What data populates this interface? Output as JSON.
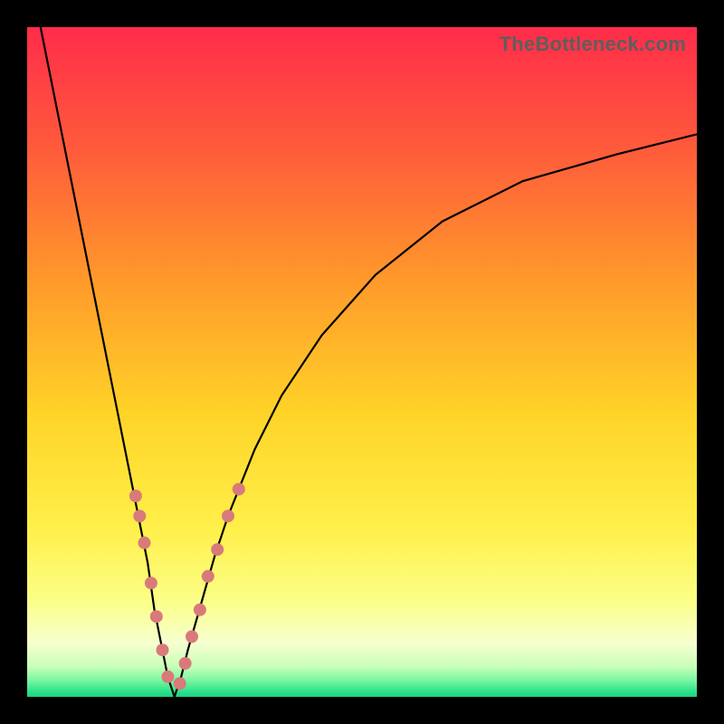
{
  "watermark": "TheBottleneck.com",
  "colors": {
    "frame_bg": "#000000",
    "curve": "#000000",
    "marker": "#d97a7a"
  },
  "gradient_stops": [
    {
      "offset": 0.0,
      "color": "#ff2c4a"
    },
    {
      "offset": 0.18,
      "color": "#ff5a3b"
    },
    {
      "offset": 0.38,
      "color": "#ff9a2a"
    },
    {
      "offset": 0.58,
      "color": "#ffd428"
    },
    {
      "offset": 0.75,
      "color": "#fff04a"
    },
    {
      "offset": 0.86,
      "color": "#fbff8a"
    },
    {
      "offset": 0.92,
      "color": "#f6ffd0"
    },
    {
      "offset": 0.955,
      "color": "#c8ffb8"
    },
    {
      "offset": 0.975,
      "color": "#7bf7a2"
    },
    {
      "offset": 0.99,
      "color": "#34e58e"
    },
    {
      "offset": 1.0,
      "color": "#18d47e"
    }
  ],
  "chart_data": {
    "type": "line",
    "title": "",
    "xlabel": "",
    "ylabel": "",
    "xlim": [
      0,
      100
    ],
    "ylim": [
      0,
      100
    ],
    "x_trough": 22,
    "series": [
      {
        "name": "left-branch",
        "x": [
          2,
          4,
          6,
          8,
          10,
          12,
          14,
          16,
          18,
          19,
          20,
          21,
          22
        ],
        "y": [
          100,
          90,
          80,
          70,
          60,
          50,
          40,
          30,
          20,
          13,
          8,
          3,
          0
        ]
      },
      {
        "name": "right-branch",
        "x": [
          22,
          23,
          24,
          26,
          28,
          30,
          34,
          38,
          44,
          52,
          62,
          74,
          88,
          100
        ],
        "y": [
          0,
          3,
          7,
          14,
          21,
          27,
          37,
          45,
          54,
          63,
          71,
          77,
          81,
          84
        ]
      }
    ],
    "markers": [
      {
        "branch": "left-branch",
        "x": 16.2,
        "y": 30
      },
      {
        "branch": "left-branch",
        "x": 16.8,
        "y": 27
      },
      {
        "branch": "left-branch",
        "x": 17.5,
        "y": 23
      },
      {
        "branch": "left-branch",
        "x": 18.5,
        "y": 17
      },
      {
        "branch": "left-branch",
        "x": 19.3,
        "y": 12
      },
      {
        "branch": "left-branch",
        "x": 20.2,
        "y": 7
      },
      {
        "branch": "left-branch",
        "x": 21.0,
        "y": 3
      },
      {
        "branch": "right-branch",
        "x": 22.8,
        "y": 2
      },
      {
        "branch": "right-branch",
        "x": 23.6,
        "y": 5
      },
      {
        "branch": "right-branch",
        "x": 24.6,
        "y": 9
      },
      {
        "branch": "right-branch",
        "x": 25.8,
        "y": 13
      },
      {
        "branch": "right-branch",
        "x": 27.0,
        "y": 18
      },
      {
        "branch": "right-branch",
        "x": 28.4,
        "y": 22
      },
      {
        "branch": "right-branch",
        "x": 30.0,
        "y": 27
      },
      {
        "branch": "right-branch",
        "x": 31.6,
        "y": 31
      }
    ],
    "marker_radius": 7
  }
}
